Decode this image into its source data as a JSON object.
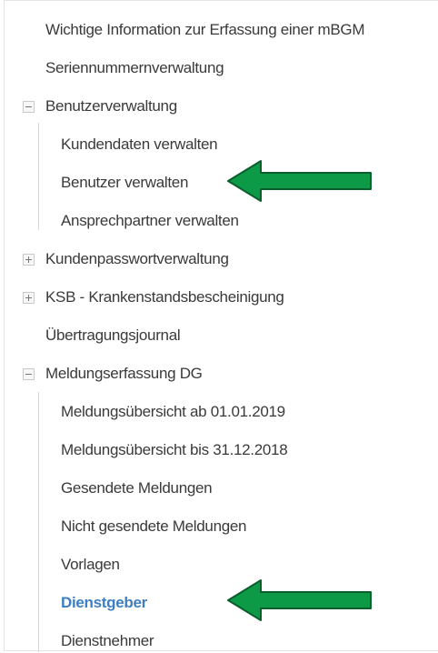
{
  "nav": {
    "items": [
      {
        "label": "Wichtige Information zur Erfassung einer mBGM"
      },
      {
        "label": "Seriennummernverwaltung"
      },
      {
        "label": "Benutzerverwaltung",
        "expanded": true
      },
      {
        "label": "Kundendaten verwalten"
      },
      {
        "label": "Benutzer verwalten",
        "highlighted": true
      },
      {
        "label": "Ansprechpartner verwalten"
      },
      {
        "label": "Kundenpasswortverwaltung",
        "expanded": false
      },
      {
        "label": "KSB - Krankenstandsbescheinigung",
        "expanded": false
      },
      {
        "label": "Übertragungsjournal"
      },
      {
        "label": "Meldungserfassung DG",
        "expanded": true
      },
      {
        "label": "Meldungsübersicht ab 01.01.2019"
      },
      {
        "label": "Meldungsübersicht bis 31.12.2018"
      },
      {
        "label": "Gesendete Meldungen"
      },
      {
        "label": "Nicht gesendete Meldungen"
      },
      {
        "label": "Vorlagen"
      },
      {
        "label": "Dienstgeber",
        "active": true,
        "highlighted": true
      },
      {
        "label": "Dienstnehmer"
      }
    ]
  },
  "colors": {
    "text": "#3a3a3a",
    "active": "#3d7fc1",
    "arrow_fill": "#0c9a47",
    "arrow_border": "#0a5e2e"
  },
  "icons": {
    "collapse": "minus-square-icon",
    "expand": "plus-square-icon",
    "annotation": "left-arrow-icon"
  }
}
